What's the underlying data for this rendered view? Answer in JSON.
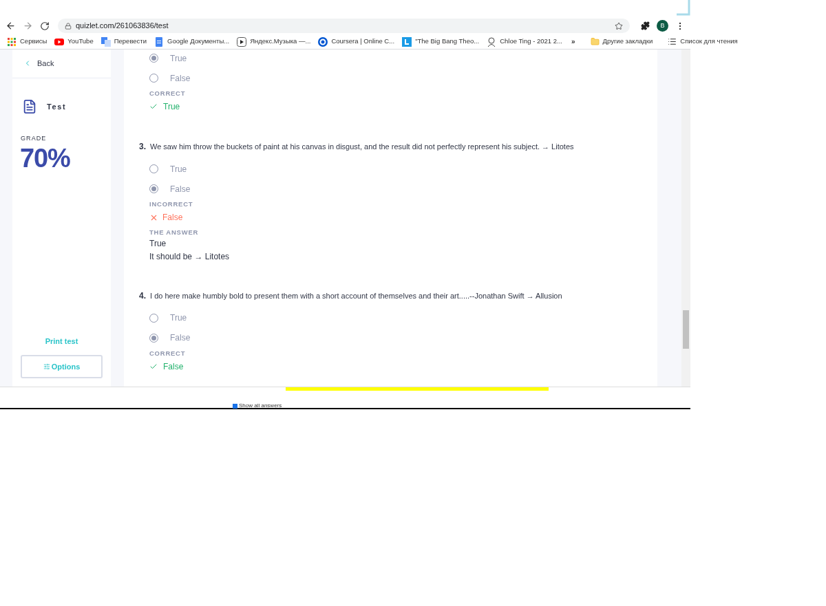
{
  "browser": {
    "url": "quizlet.com/261063836/test",
    "profile_initial": "B",
    "bookmarks": [
      {
        "label": "Сервисы"
      },
      {
        "label": "YouTube"
      },
      {
        "label": "Перевести"
      },
      {
        "label": "Google Документы..."
      },
      {
        "label": "Яндекс.Музыка —..."
      },
      {
        "label": "Coursera | Online C..."
      },
      {
        "label": "\"The Big Bang Theo..."
      },
      {
        "label": "Chloe Ting - 2021 2..."
      }
    ],
    "more": "»",
    "other_bookmarks": "Другие закладки",
    "reading_list": "Список для чтения"
  },
  "sidebar": {
    "back": "Back",
    "title": "Test",
    "grade_label": "GRADE",
    "grade": "70%",
    "print": "Print test",
    "options": "Options"
  },
  "questions": [
    {
      "options": [
        {
          "label": "True",
          "selected": true
        },
        {
          "label": "False",
          "selected": false
        }
      ],
      "result": {
        "kind": "correct",
        "heading": "CORRECT",
        "answer": "True"
      }
    },
    {
      "number": "3.",
      "text": "We saw him throw the buckets of paint at his canvas in disgust, and the result did not perfectly represent his subject. → Litotes",
      "options": [
        {
          "label": "True",
          "selected": false
        },
        {
          "label": "False",
          "selected": true
        }
      ],
      "result": {
        "kind": "incorrect",
        "heading": "INCORRECT",
        "answer": "False"
      },
      "correction": {
        "heading": "THE ANSWER",
        "answer": "True",
        "note": "It should be → Litotes"
      }
    },
    {
      "number": "4.",
      "text": "I do here make humbly bold to present them with a short account of themselves and their art.....--Jonathan Swift → Allusion",
      "options": [
        {
          "label": "True",
          "selected": false
        },
        {
          "label": "False",
          "selected": true
        }
      ],
      "result": {
        "kind": "correct",
        "heading": "CORRECT",
        "answer": "False"
      }
    }
  ],
  "under_page": {
    "show_all_answers": {
      "label": "Show all answers",
      "checked": true
    }
  }
}
